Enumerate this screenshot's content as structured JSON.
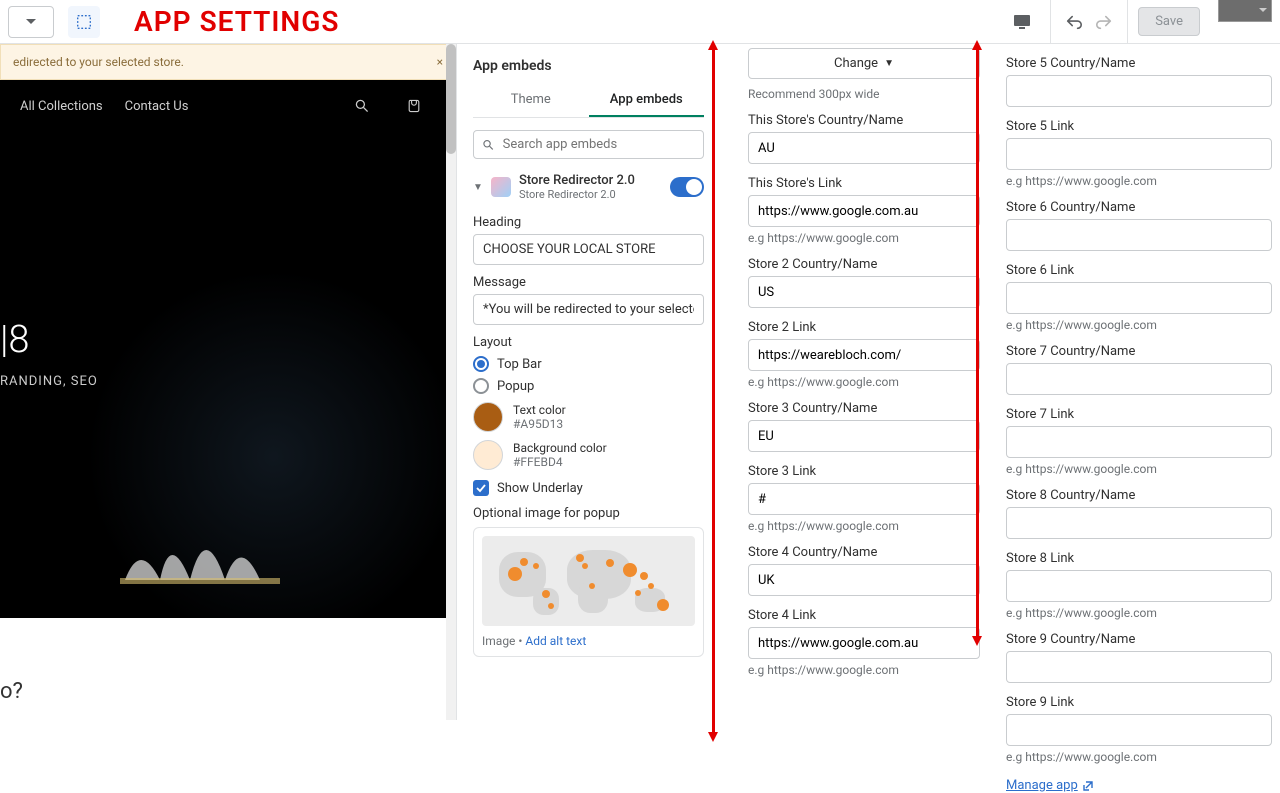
{
  "title": "APP SETTINGS",
  "toolbar": {
    "save_label": "Save"
  },
  "notice": {
    "text": "edirected to your selected store."
  },
  "preview": {
    "nav1": "All Collections",
    "nav2": "Contact Us",
    "big": "|8",
    "sub": "RANDING, SEO",
    "bottom": "o?"
  },
  "panel": {
    "heading": "App embeds",
    "tab_theme": "Theme",
    "tab_embeds": "App embeds",
    "search_placeholder": "Search app embeds",
    "app_name": "Store Redirector 2.0",
    "app_vendor": "Store Redirector 2.0",
    "heading_label": "Heading",
    "heading_value": "CHOOSE YOUR LOCAL STORE",
    "message_label": "Message",
    "message_value": "*You will be redirected to your selected",
    "layout_label": "Layout",
    "layout_opt1": "Top Bar",
    "layout_opt2": "Popup",
    "textcolor_label": "Text color",
    "textcolor_value": "#A95D13",
    "bgcolor_label": "Background color",
    "bgcolor_value": "#FFEBD4",
    "underlay_label": "Show Underlay",
    "optimage_label": "Optional image for popup",
    "image_meta_prefix": "Image • ",
    "image_meta_link": "Add alt text"
  },
  "col3": {
    "change": "Change",
    "recommend": "Recommend 300px wide",
    "s1_name_label": "This Store's Country/Name",
    "s1_name_value": "AU",
    "s1_link_label": "This Store's Link",
    "s1_link_value": "https://www.google.com.au",
    "hint": "e.g https://www.google.com",
    "s2_name_label": "Store 2 Country/Name",
    "s2_name_value": "US",
    "s2_link_label": "Store 2 Link",
    "s2_link_value": "https://wearebloch.com/",
    "s3_name_label": "Store 3 Country/Name",
    "s3_name_value": "EU",
    "s3_link_label": "Store 3 Link",
    "s3_link_value": "#",
    "s4_name_label": "Store 4 Country/Name",
    "s4_name_value": "UK",
    "s4_link_label": "Store 4 Link",
    "s4_link_value": "https://www.google.com.au"
  },
  "col4": {
    "s5_name_label": "Store 5 Country/Name",
    "s5_link_label": "Store 5 Link",
    "s6_name_label": "Store 6 Country/Name",
    "s6_link_label": "Store 6 Link",
    "s7_name_label": "Store 7 Country/Name",
    "s7_link_label": "Store 7 Link",
    "s8_name_label": "Store 8 Country/Name",
    "s8_link_label": "Store 8 Link",
    "s9_name_label": "Store 9 Country/Name",
    "s9_link_label": "Store 9 Link",
    "hint": "e.g https://www.google.com",
    "manage": "Manage app"
  }
}
